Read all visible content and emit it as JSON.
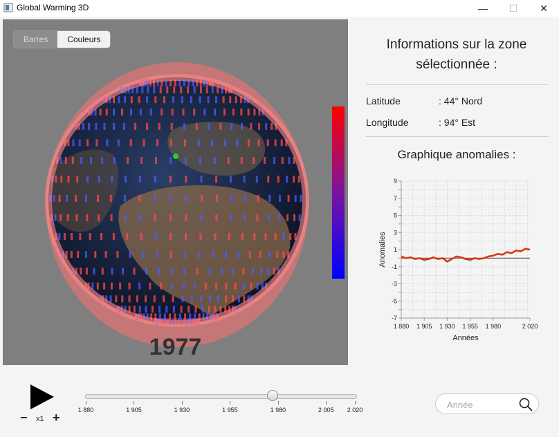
{
  "window": {
    "title": "Global Warming 3D",
    "minimize": "—",
    "maximize": "☐",
    "close": "✕"
  },
  "viewport": {
    "toggle": {
      "bars_label": "Barres",
      "colors_label": "Couleurs",
      "selected": "Couleurs"
    },
    "year": "1977",
    "color_scale": {
      "top_color": "#ff0000",
      "mid_color": "#7a14a0",
      "bottom_color": "#0000ff"
    }
  },
  "info": {
    "title_line1": "Informations sur la zone",
    "title_line2": "sélectionnée :",
    "latitude_label": "Latitude",
    "latitude_value": ": 44° Nord",
    "longitude_label": "Longitude",
    "longitude_value": ": 94° Est",
    "graph_title": "Graphique anomalies :"
  },
  "chart_data": {
    "type": "line",
    "title": "",
    "xlabel": "Années",
    "ylabel": "Anomalies",
    "xlim": [
      1880,
      2020
    ],
    "ylim": [
      -7,
      9
    ],
    "x_ticks": [
      1880,
      1905,
      1930,
      1955,
      1980,
      2020
    ],
    "x_tick_labels": [
      "1 880",
      "1 905",
      "1 930",
      "1 955",
      "1 980",
      "2 020"
    ],
    "y_ticks": [
      -7,
      -5,
      -3,
      -1,
      1,
      3,
      5,
      7,
      9
    ],
    "y_tick_labels": [
      "-7",
      "-5",
      "-3",
      "-1",
      "1",
      "3",
      "5",
      "7",
      "9"
    ],
    "grid": true,
    "baseline": 0,
    "series_color": "#d63a12",
    "series": [
      {
        "x": [
          1880,
          1885,
          1890,
          1895,
          1900,
          1905,
          1910,
          1915,
          1920,
          1925,
          1930,
          1935,
          1940,
          1945,
          1950,
          1955,
          1960,
          1965,
          1970,
          1975,
          1980,
          1985,
          1990,
          1995,
          2000,
          2005,
          2010,
          2015,
          2020
        ],
        "values": [
          0.2,
          0.0,
          0.1,
          -0.1,
          0.0,
          -0.2,
          -0.1,
          0.1,
          -0.1,
          0.0,
          -0.4,
          -0.1,
          0.2,
          0.1,
          -0.1,
          -0.2,
          0.0,
          -0.1,
          0.0,
          0.2,
          0.3,
          0.5,
          0.4,
          0.7,
          0.6,
          0.9,
          0.8,
          1.1,
          1.0
        ]
      }
    ]
  },
  "controls": {
    "play": "play",
    "speed_minus": "−",
    "speed_label": "x1",
    "speed_plus": "+",
    "slider": {
      "min": 1880,
      "max": 2020,
      "value": 1977
    },
    "slider_ticks": [
      {
        "label": "1 880",
        "value": 1880
      },
      {
        "label": "1 905",
        "value": 1905
      },
      {
        "label": "1 930",
        "value": 1930
      },
      {
        "label": "1 955",
        "value": 1955
      },
      {
        "label": "1 980",
        "value": 1980
      },
      {
        "label": "2 005",
        "value": 2005
      },
      {
        "label": "2 020",
        "value": 2020
      }
    ],
    "search_placeholder": "Année"
  }
}
